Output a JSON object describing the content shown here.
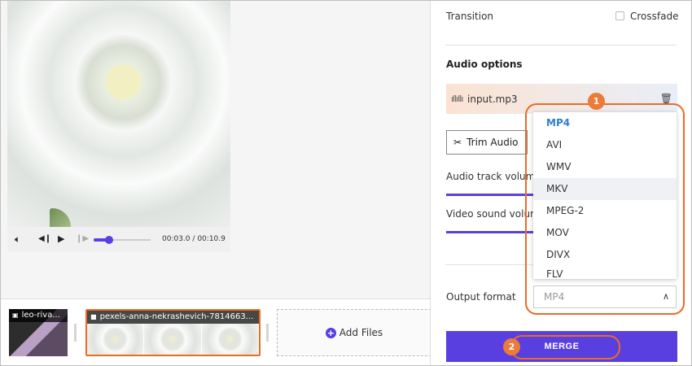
{
  "player": {
    "time_current": "00:03.0",
    "time_separator": "/",
    "time_total": "00:10.9",
    "progress_fraction": 0.27,
    "icons": [
      "volume-icon",
      "step-back-icon",
      "play-icon",
      "step-forward-icon"
    ]
  },
  "timeline": {
    "clips": [
      {
        "title": "leo-riva..."
      },
      {
        "title": "pexels-anna-nekrashevich-7814663..."
      }
    ],
    "add_files_label": "Add Files"
  },
  "settings": {
    "transition_label": "Transition",
    "crossfade_label": "Crossfade",
    "audio_options_label": "Audio options",
    "audio_file": "input.mp3",
    "trim_audio_label": "Trim Audio",
    "audio_track_volume_label": "Audio track volume",
    "video_sound_volume_label": "Video sound volume",
    "output_format_label": "Output format",
    "output_format_value": "MP4",
    "format_options": [
      "MP4",
      "AVI",
      "WMV",
      "MKV",
      "MPEG-2",
      "MOV",
      "DIVX",
      "FLV"
    ],
    "merge_label": "MERGE"
  },
  "callouts": {
    "badge_1": "1",
    "badge_2": "2"
  },
  "colors": {
    "accent": "#5a3fe0",
    "callout": "#ec6b22",
    "selected_option": "#2f7fd0"
  }
}
